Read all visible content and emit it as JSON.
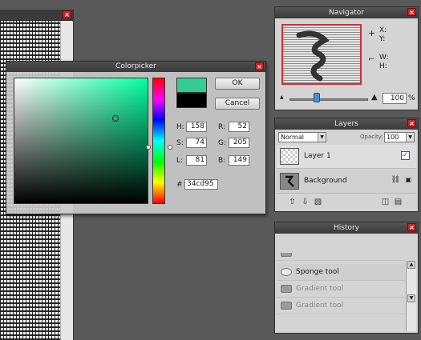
{
  "navigator": {
    "title": "Navigator",
    "x_label": "X:",
    "y_label": "Y:",
    "w_label": "W:",
    "h_label": "H:",
    "zoom_value": "100",
    "zoom_unit": "%",
    "zoom_level_fraction": 0.35
  },
  "layers": {
    "title": "Layers",
    "blend_mode": "Normal",
    "opacity_label": "Opacity:",
    "opacity_value": "100",
    "items": [
      {
        "name": "Layer 1",
        "visible": true
      },
      {
        "name": "Background",
        "locked": true
      }
    ]
  },
  "history": {
    "title": "History",
    "items": [
      {
        "label": "Sponge tool",
        "active": true
      },
      {
        "label": "Gradient tool",
        "active": false
      },
      {
        "label": "Gradient tool",
        "active": false
      }
    ]
  },
  "colorpicker": {
    "title": "Colorpicker",
    "ok_label": "OK",
    "cancel_label": "Cancel",
    "new_color": "#34cd95",
    "old_color": "#000000",
    "h_label": "H:",
    "h_value": "158",
    "s_label": "S:",
    "s_value": "74",
    "l_label": "L:",
    "l_value": "81",
    "r_label": "R:",
    "r_value": "52",
    "g_label": "G:",
    "g_value": "205",
    "b_label": "B:",
    "b_value": "149",
    "hex_label": "#",
    "hex_value": "34cd95"
  },
  "icons": {
    "close": "×",
    "crosshair": "+",
    "resize": "⌐",
    "mountain_small": "▲",
    "mountain_large": "▲",
    "check": "✓",
    "link": "⛓",
    "lock": "🔒"
  },
  "colors": {
    "workspace": "#595959",
    "panel": "#d4d4d4",
    "close_red": "#cf2222"
  }
}
